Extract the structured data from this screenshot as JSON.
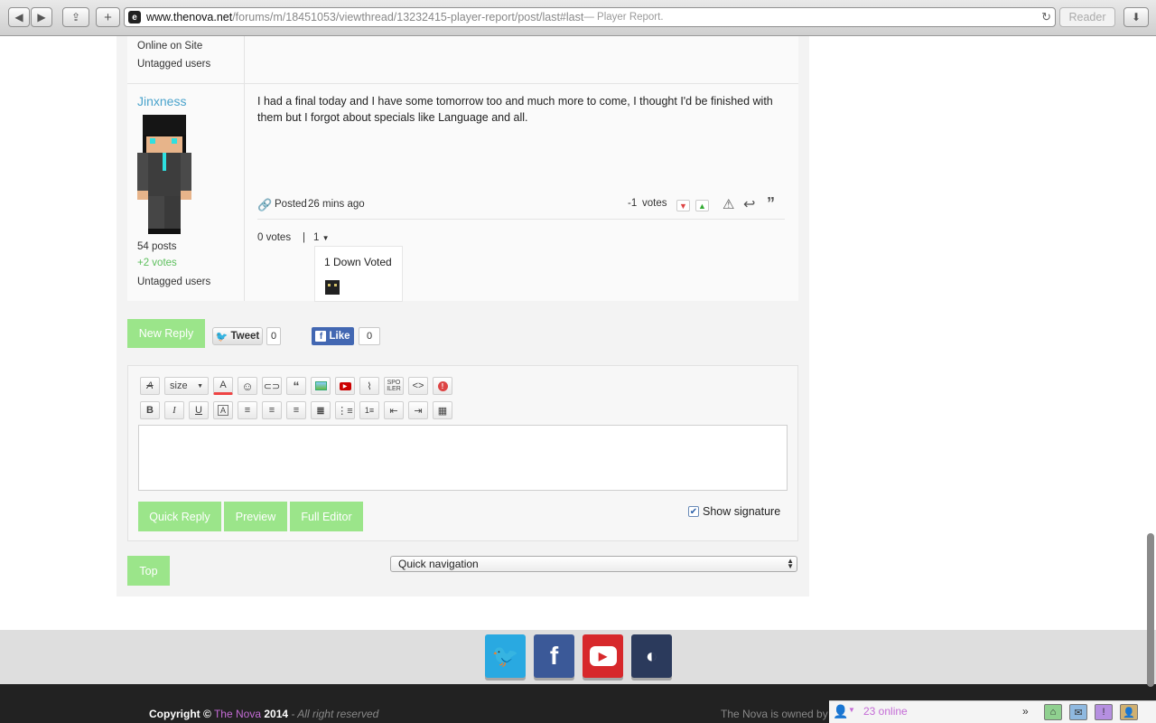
{
  "browser": {
    "url_domain": "www.thenova.net",
    "url_path": "/forums/m/18451053/viewthread/13232415-player-report/post/last#last",
    "page_title": " — Player Report.",
    "reader_label": "Reader"
  },
  "prev_post": {
    "online_status": "Online on Site",
    "tag": "Untagged users"
  },
  "post": {
    "username": "Jinxness",
    "posts_count": "54 posts",
    "votes_count": "+2 votes",
    "tag": "Untagged users",
    "body": "I had a final today and I have some tomorrow too and much more to come, I thought I'd be finished with them but I forgot about specials like Language and all.",
    "posted_prefix": "Posted",
    "posted_time": "26 mins ago",
    "score": "-1",
    "votes_label": "votes",
    "sub_votes": "0 votes",
    "sub_separator": "|",
    "dropdown_value": "1",
    "dropdown_header": "1 Down Voted"
  },
  "actions": {
    "new_reply": "New Reply",
    "tweet": "Tweet",
    "tweet_count": "0",
    "like": "Like",
    "like_count": "0"
  },
  "editor": {
    "size_label": "size",
    "spoiler_label": "SPO ILER",
    "toolbar_row1_icons": [
      "remove-format-icon",
      "font-size-select",
      "font-color-icon",
      "emoticon-icon",
      "link-icon",
      "quote-icon",
      "image-icon",
      "youtube-icon",
      "attachment-icon",
      "spoiler-icon",
      "code-icon",
      "alert-icon"
    ],
    "toolbar_row2_icons": [
      "bold-icon",
      "italic-icon",
      "underline-icon",
      "background-color-icon",
      "align-left-icon",
      "align-center-icon",
      "align-right-icon",
      "justify-icon",
      "bullet-list-icon",
      "numbered-list-icon",
      "outdent-icon",
      "indent-icon",
      "table-icon"
    ],
    "quick_reply": "Quick Reply",
    "preview": "Preview",
    "full_editor": "Full Editor",
    "show_signature": "Show signature",
    "show_signature_checked": true
  },
  "navigation": {
    "top": "Top",
    "quick_navigation": "Quick navigation"
  },
  "social": [
    "twitter-icon",
    "facebook-icon",
    "youtube-icon",
    "teamspeak-icon"
  ],
  "footer": {
    "copyright_prefix": "Copyright ©",
    "brand": "The Nova",
    "year": "2014",
    "rights": "- All right reserved",
    "owned_by": "The Nova is owned by",
    "online_count": "23 online"
  },
  "colors": {
    "accent_green": "#9be58a",
    "username_blue": "#4aa3cc",
    "brand_purple": "#c46bd6",
    "footer_bg": "#222222"
  }
}
